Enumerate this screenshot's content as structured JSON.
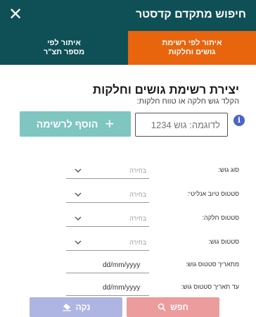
{
  "header": {
    "title": "חיפוש מתקדם קדסטר",
    "close_icon": "✕"
  },
  "tabs": [
    {
      "line1": "איתור לפי רשימת",
      "line2": "גושים וחלקות",
      "active": true
    },
    {
      "line1": "איתור לפי",
      "line2": "מספר תצ\"ר",
      "active": false
    }
  ],
  "section": {
    "title": "יצירת רשימת גושים וחלקות",
    "subtitle": "הקלד גוש חלקה או טווח חלקות:"
  },
  "search": {
    "placeholder": "לדוגמה: גוש 1234",
    "value": "",
    "info_icon": "i"
  },
  "add_button": {
    "label": "הוסף לרשימה",
    "icon": "+"
  },
  "filters": [
    {
      "label": "סוג גוש:",
      "value": "בחירה",
      "type": "select"
    },
    {
      "label": "סטטוס טיוב אנליטי:",
      "value": "בחירה",
      "type": "select"
    },
    {
      "label": "סטטוס חלקה:",
      "value": "בחירה",
      "type": "select"
    },
    {
      "label": "סטטוס גוש:",
      "value": "בחירה",
      "type": "select"
    },
    {
      "label": "מתאריך סטטוס גוש:",
      "value": "dd/mm/yyyy",
      "type": "date"
    },
    {
      "label": "עד תאריך סטטוס גוש:",
      "value": "dd/mm/yyyy",
      "type": "date"
    }
  ],
  "actions": {
    "search_label": "חפש",
    "clear_label": "נקה",
    "search_icon": "search-icon",
    "clear_icon": "eraser-icon",
    "search_color": "#ec9c9c",
    "clear_color": "#aeb5e2"
  },
  "colors": {
    "header": "#0f4f56",
    "active_tab": "#e8650e",
    "add_button": "#7ec6bf",
    "info": "#4a64c9"
  }
}
